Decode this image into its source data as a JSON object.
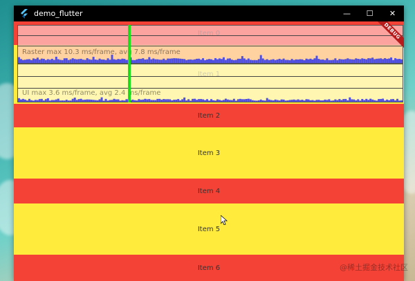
{
  "window": {
    "title": "demo_flutter"
  },
  "controls": {
    "minimize": "—",
    "maximize": "☐",
    "close": "✕"
  },
  "items": [
    {
      "label": "Item 0",
      "color": "red"
    },
    {
      "label": "Item 1",
      "color": "yellow"
    },
    {
      "label": "Item 2",
      "color": "red"
    },
    {
      "label": "Item 3",
      "color": "yellow"
    },
    {
      "label": "Item 4",
      "color": "red"
    },
    {
      "label": "Item 5",
      "color": "yellow"
    },
    {
      "label": "Item 6",
      "color": "red"
    }
  ],
  "overlay": {
    "raster_label": "Raster  max 10.3 ms/frame, avg 7.8 ms/frame",
    "ui_label": "UI  max 3.6 ms/frame, avg 2.4 ms/frame"
  },
  "debug_banner": "DEBUG",
  "watermark": "@稀土掘金技术社区",
  "colors": {
    "red": "#f44336",
    "yellow": "#ffeb3b",
    "accent": "#1adf1a",
    "bars": "#5050e0"
  }
}
